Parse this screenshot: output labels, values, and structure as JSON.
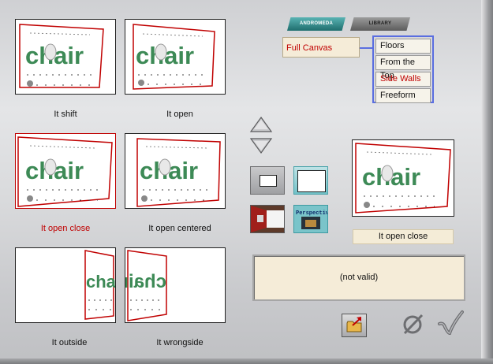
{
  "thumbnails": [
    {
      "caption": "It shift",
      "selected": false
    },
    {
      "caption": "It open",
      "selected": false
    },
    {
      "caption": "It open close",
      "selected": true
    },
    {
      "caption": "It open centered",
      "selected": false
    },
    {
      "caption": "It outside",
      "selected": false
    },
    {
      "caption": "It wrongside",
      "selected": false
    }
  ],
  "artwork_text": "chair",
  "tabs": [
    {
      "label": "ANDROMEDA",
      "active": true
    },
    {
      "label": "LIBRARY",
      "active": false
    }
  ],
  "canvas_combo": {
    "value": "Full Canvas"
  },
  "canvas_options": [
    {
      "label": "Floors",
      "active": false
    },
    {
      "label": "From the Top",
      "active": false
    },
    {
      "label": "Side Walls",
      "active": true
    },
    {
      "label": "Freeform",
      "active": false
    }
  ],
  "buttons": {
    "arrow_up": "up-arrow-icon",
    "arrow_down": "down-arrow-icon",
    "perspective_label": "Perspective"
  },
  "preview": {
    "label": "It open close"
  },
  "status": {
    "text": "(not valid)"
  },
  "colors": {
    "selection": "#c00000",
    "list_border": "#5a6ee0",
    "panel_fill": "#f5ecd8",
    "art_green": "#3d8a56"
  }
}
